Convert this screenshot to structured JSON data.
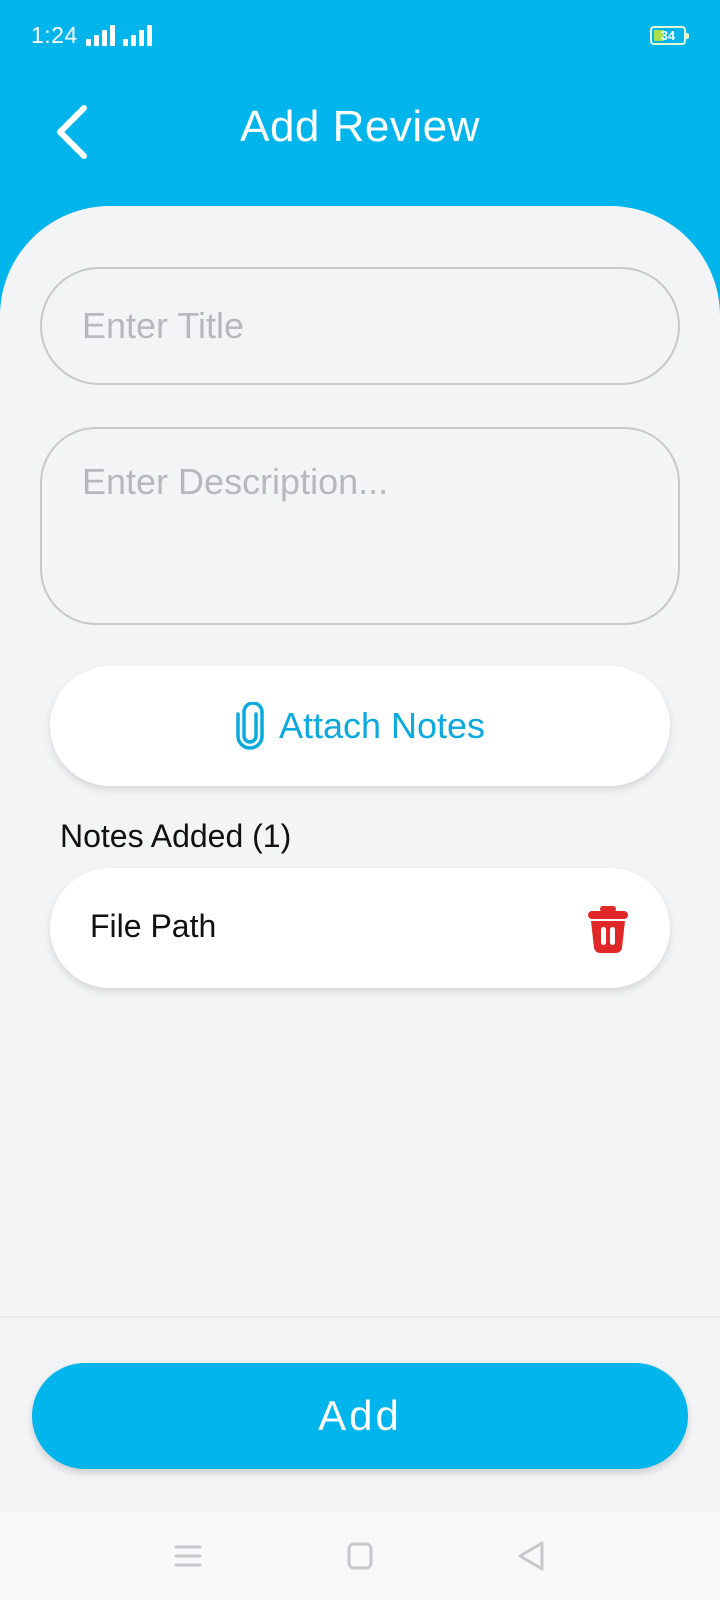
{
  "status_bar": {
    "time": "1:24",
    "battery_level": "34",
    "icons": [
      "signal-icon",
      "signal-icon",
      "battery-icon"
    ]
  },
  "header": {
    "title": "Add Review",
    "back_icon": "chevron-left-icon",
    "color": "#00b5eb"
  },
  "form": {
    "title_placeholder": "Enter Title",
    "title_value": "",
    "description_placeholder": "Enter Description...",
    "description_value": ""
  },
  "attach": {
    "label": "Attach Notes",
    "icon": "paperclip-icon",
    "color": "#0ba9dc"
  },
  "notes": {
    "heading": "Notes Added (1)",
    "items": [
      {
        "label": "File Path",
        "delete_icon": "trash-icon"
      }
    ],
    "delete_color": "#e02828"
  },
  "footer": {
    "add_label": "Add"
  },
  "nav_bar": {
    "icons": [
      "menu-icon",
      "home-square-icon",
      "back-triangle-icon"
    ]
  }
}
